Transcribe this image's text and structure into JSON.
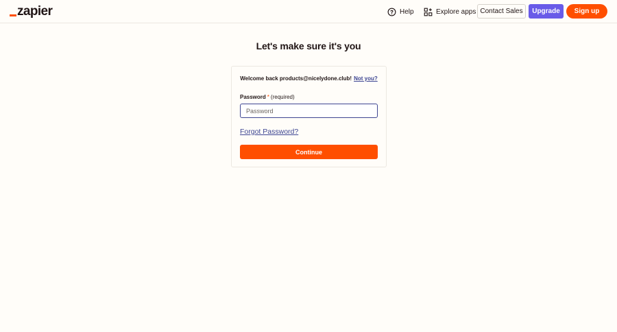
{
  "logo": {
    "text": "zapier"
  },
  "header": {
    "help_label": "Help",
    "help_icon": "question-circle-icon",
    "explore_label": "Explore apps",
    "explore_icon": "apps-grid-icon",
    "contact_label": "Contact Sales",
    "upgrade_label": "Upgrade",
    "signup_label": "Sign up"
  },
  "main": {
    "heading": "Let's make sure it's you",
    "welcome_text": "Welcome back products@nicelydone.club!",
    "not_you_label": "Not you?",
    "password_label": "Password",
    "required_marker": "*",
    "required_text": "(required)",
    "password_value": "",
    "password_placeholder": "Password",
    "forgot_label": "Forgot Password?",
    "continue_label": "Continue"
  },
  "colors": {
    "brand_orange": "#ff4f00",
    "upgrade_purple": "#695be8",
    "link_blue": "#3d4592",
    "background": "#fffdf9"
  }
}
